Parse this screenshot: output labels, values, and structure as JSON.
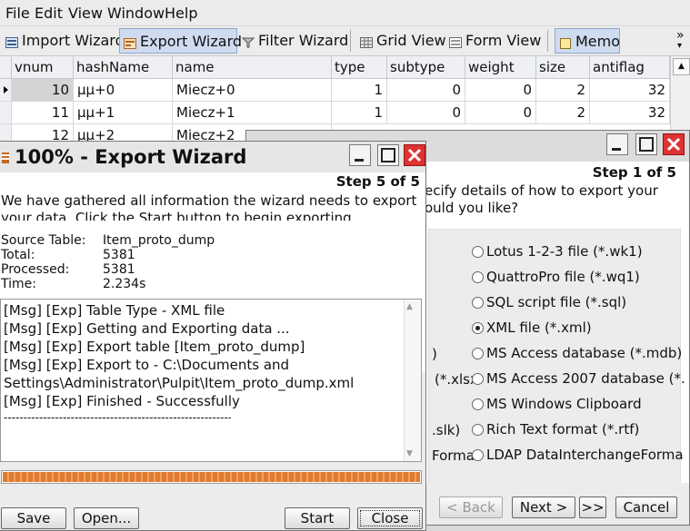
{
  "menu": [
    "File",
    "Edit",
    "View",
    "Window",
    "Help"
  ],
  "toolbar": {
    "import_wizard": "Import Wizard",
    "export_wizard": "Export Wizard",
    "filter_wizard": "Filter Wizard",
    "grid_view": "Grid View",
    "form_view": "Form View",
    "memo": "Memo",
    "overflow": "»"
  },
  "grid": {
    "columns": [
      "vnum",
      "hashName",
      "name",
      "type",
      "subtype",
      "weight",
      "size",
      "antiflag"
    ],
    "rows": [
      {
        "vnum": "10",
        "hashName": "µµ+0",
        "name": "Miecz+0",
        "type": "1",
        "subtype": "0",
        "weight": "0",
        "size": "2",
        "antiflag": "32"
      },
      {
        "vnum": "11",
        "hashName": "µµ+1",
        "name": "Miecz+1",
        "type": "1",
        "subtype": "0",
        "weight": "0",
        "size": "2",
        "antiflag": "32"
      },
      {
        "vnum": "12",
        "hashName": "µµ+2",
        "name": "Miecz+2",
        "type": "",
        "subtype": "",
        "weight": "",
        "size": "",
        "antiflag": ""
      }
    ]
  },
  "back_wizard": {
    "step": "Step 1 of 5",
    "intro_line1": "ecify details of how to export your",
    "intro_line2": "ould you like?",
    "left_fragments": [
      ")",
      "(*.xlsx",
      ".slk)",
      "Forma"
    ],
    "options": [
      {
        "label": "Lotus 1-2-3 file (*.wk1)",
        "selected": false
      },
      {
        "label": "QuattroPro file (*.wq1)",
        "selected": false
      },
      {
        "label": "SQL script file (*.sql)",
        "selected": false
      },
      {
        "label": "XML file (*.xml)",
        "selected": true
      },
      {
        "label": "MS Access database (*.mdb)",
        "selected": false
      },
      {
        "label": "MS Access 2007 database (*.",
        "selected": false
      },
      {
        "label": "MS Windows Clipboard",
        "selected": false
      },
      {
        "label": "Rich Text format (*.rtf)",
        "selected": false
      },
      {
        "label": "LDAP DataInterchangeForma",
        "selected": false
      }
    ],
    "back_button": "< Back",
    "next_button": "Next >",
    "skip_button": ">>",
    "cancel_button": "Cancel"
  },
  "export_wizard": {
    "title": "100% - Export Wizard",
    "step": "Step 5 of 5",
    "intro_line1": "We have gathered all information the wizard needs to export",
    "intro_line2": "your data. Click the Start button to begin exporting.",
    "source_table_label": "Source Table:",
    "source_table_value": "Item_proto_dump",
    "total_label": "Total:",
    "total_value": "5381",
    "processed_label": "Processed:",
    "processed_value": "5381",
    "time_label": "Time:",
    "time_value": "2.234s",
    "log": [
      "[Msg] [Exp] Table Type - XML file",
      "[Msg] [Exp] Getting and Exporting data ...",
      "[Msg] [Exp] Export table [Item_proto_dump]",
      "[Msg] [Exp] Export to - C:\\Documents and",
      "Settings\\Administrator\\Pulpit\\Item_proto_dump.xml",
      "[Msg] [Exp] Finished - Successfully",
      "--------------------------------------------------------------------"
    ],
    "progress": 1.0,
    "save_button": "Save",
    "open_button": "Open...",
    "start_button": "Start",
    "close_button": "Close"
  },
  "colors": {
    "progress": "#e07a2e",
    "close_button": "#d33333",
    "active_toolbar": "#cfdcf0"
  }
}
